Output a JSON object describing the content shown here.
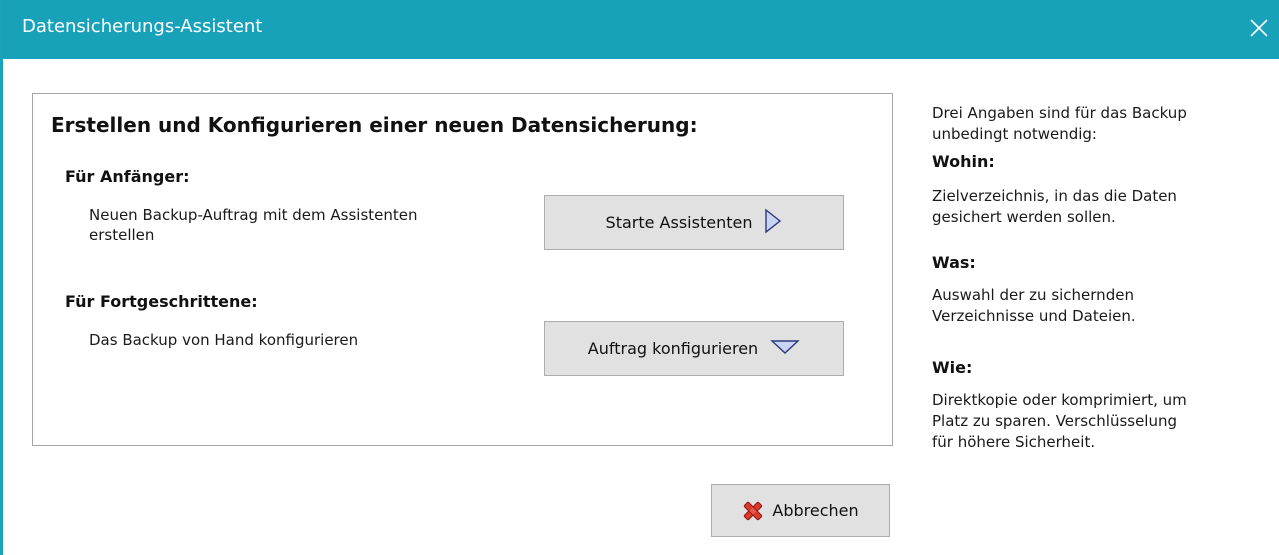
{
  "window": {
    "title": "Datensicherungs-Assistent",
    "accent_color": "#17a2ba",
    "close_icon": "close-icon"
  },
  "main": {
    "heading": "Erstellen und Konfigurieren einer neuen Datensicherung:",
    "beginner": {
      "heading": "Für Anfänger:",
      "description_line1": "Neuen Backup-Auftrag mit dem Assistenten",
      "description_line2": "erstellen",
      "button_label": "Starte Assistenten",
      "button_icon": "arrow-right-icon"
    },
    "advanced": {
      "heading": "Für Fortgeschrittene:",
      "description": "Das Backup von Hand konfigurieren",
      "button_label": "Auftrag konfigurieren",
      "button_icon": "chevron-down-icon"
    }
  },
  "info": {
    "intro_line1": "Drei Angaben sind für das Backup",
    "intro_line2": "unbedingt notwendig:",
    "where": {
      "heading": "Wohin:",
      "line1": "Zielverzeichnis, in das die Daten",
      "line2": "gesichert werden sollen."
    },
    "what": {
      "heading": "Was:",
      "line1": "Auswahl der zu sichernden",
      "line2": "Verzeichnisse und Dateien."
    },
    "how": {
      "heading": "Wie:",
      "line1": "Direktkopie oder komprimiert, um",
      "line2": "Platz zu sparen. Verschlüsselung",
      "line3": "für höhere Sicherheit."
    }
  },
  "footer": {
    "cancel_label": "Abbrechen",
    "cancel_icon": "red-x-icon"
  }
}
